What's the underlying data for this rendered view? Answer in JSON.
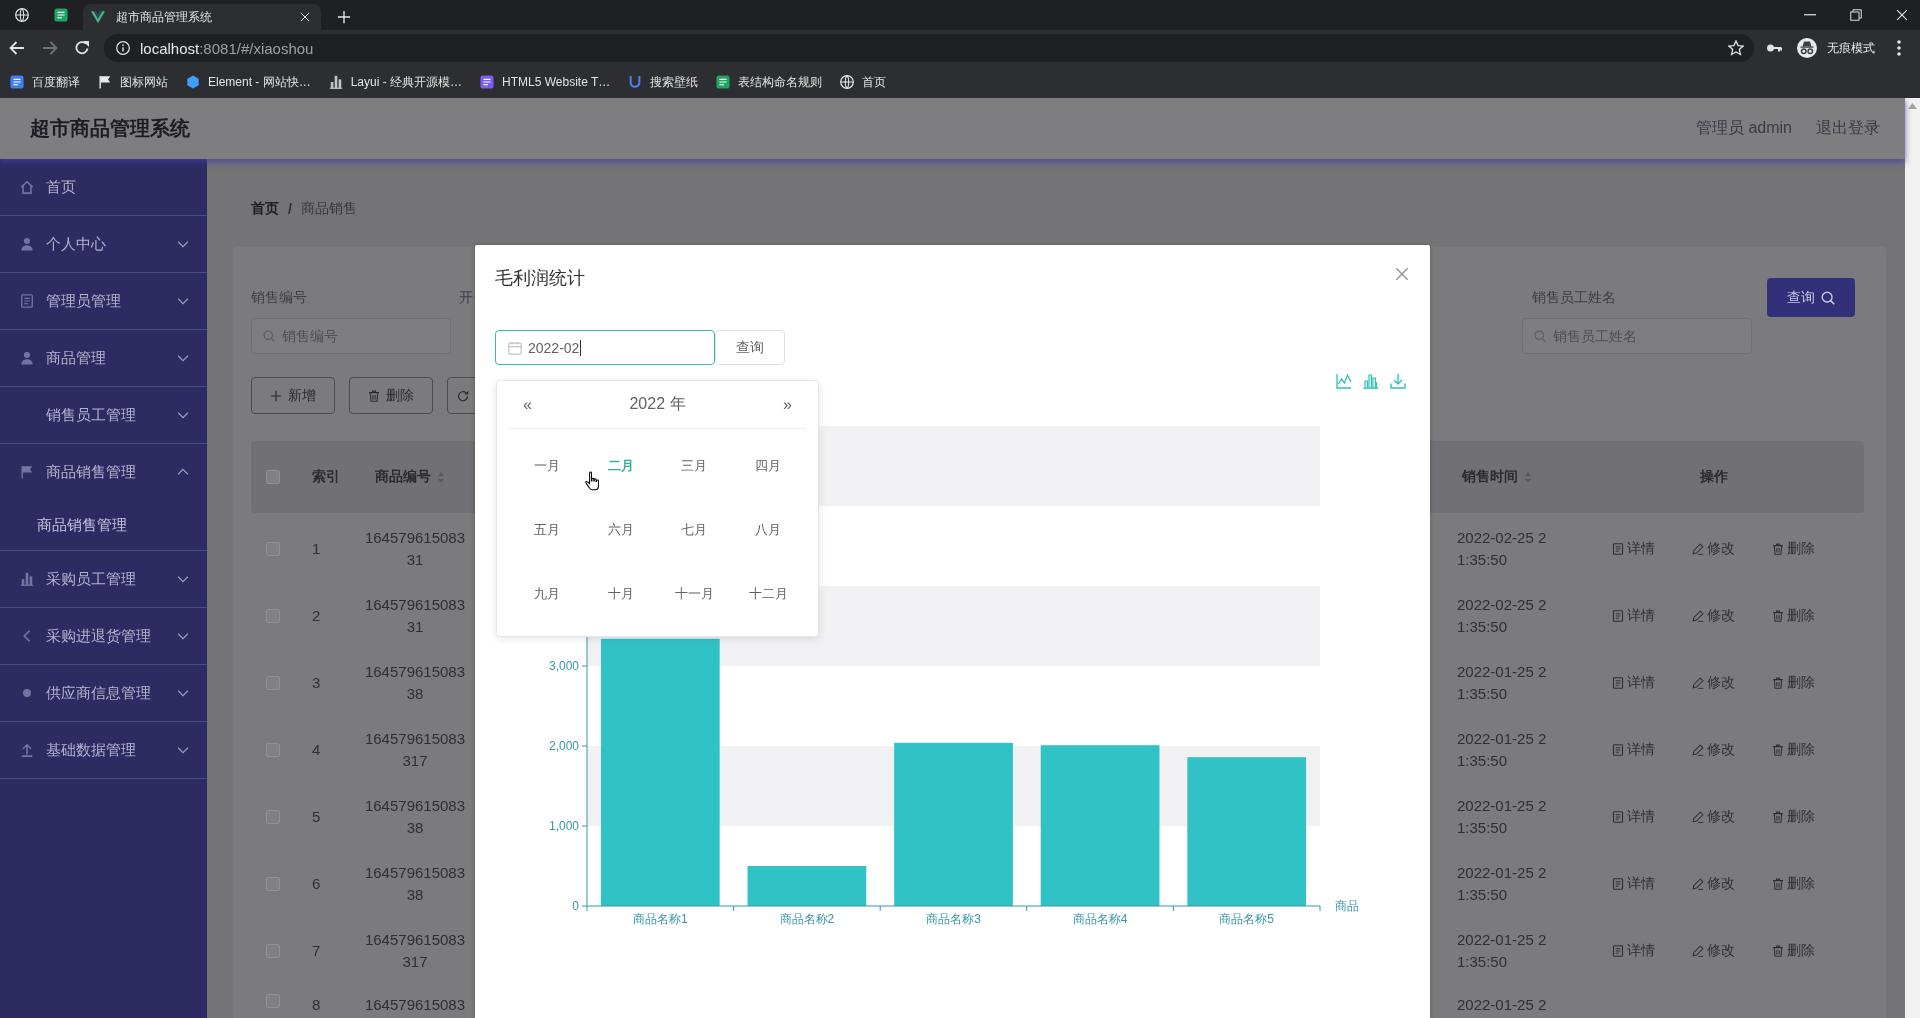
{
  "browser": {
    "tabs": [
      {
        "title": "超市商品管理系统",
        "selected": true
      }
    ],
    "url": {
      "host": "localhost",
      "path": ":8081/#/xiaoshou"
    },
    "profile_label": "无痕模式",
    "bookmarks": [
      "百度翻译",
      "图标网站",
      "Element - 网站快…",
      "Layui - 经典开源模…",
      "HTML5 Website T…",
      "搜索壁纸",
      "表结构命名规则",
      "首页"
    ]
  },
  "header": {
    "title": "超市商品管理系统",
    "user": "管理员 admin",
    "logout": "退出登录"
  },
  "sidebar": {
    "items": [
      {
        "label": "首页",
        "kind": "link"
      },
      {
        "label": "个人中心",
        "kind": "menu",
        "expanded": false
      },
      {
        "label": "管理员管理",
        "kind": "menu",
        "expanded": false
      },
      {
        "label": "商品管理",
        "kind": "menu",
        "expanded": false
      },
      {
        "label": "销售员工管理",
        "kind": "menu",
        "expanded": false
      },
      {
        "label": "商品销售管理",
        "kind": "menu",
        "expanded": true,
        "children": [
          {
            "label": "商品销售管理"
          }
        ]
      },
      {
        "label": "采购员工管理",
        "kind": "menu",
        "expanded": false
      },
      {
        "label": "采购进退货管理",
        "kind": "menu",
        "expanded": false
      },
      {
        "label": "供应商信息管理",
        "kind": "menu",
        "expanded": false
      },
      {
        "label": "基础数据管理",
        "kind": "menu",
        "expanded": false
      }
    ]
  },
  "main": {
    "breadcrumb": {
      "items": [
        "首页",
        "商品销售"
      ],
      "separator": "/"
    },
    "search_form": {
      "left_fields": [
        {
          "label": "销售编号",
          "placeholder": "销售编号"
        },
        {
          "label": "开"
        }
      ],
      "right_fields": [
        {
          "label": "销售员工姓名",
          "placeholder": "销售员工姓名"
        }
      ],
      "button": "查询"
    },
    "buttons": [
      {
        "kind": "add",
        "label": "新增"
      },
      {
        "kind": "delete",
        "label": "删除"
      },
      {
        "kind": "refresh"
      }
    ],
    "table": {
      "header_checkbox": {
        "checked": false
      },
      "columns": [
        {
          "label": "索引",
          "sortable": false
        },
        {
          "label": "商品编号",
          "sortable": true
        },
        {
          "label": "销售时间",
          "sortable": true
        },
        {
          "label": "操作",
          "sortable": false
        }
      ],
      "rows": [
        {
          "checked": false,
          "index": "1",
          "code": "16457961508331",
          "time": "2022-02-25 21:35:50",
          "actions": [
            {
              "kind": "detail",
              "label": "详情"
            },
            {
              "kind": "edit",
              "label": "修改"
            },
            {
              "kind": "delete",
              "label": "删除"
            }
          ]
        },
        {
          "checked": false,
          "index": "2",
          "code": "16457961508331",
          "time": "2022-02-25 21:35:50",
          "actions": [
            {
              "kind": "detail",
              "label": "详情"
            },
            {
              "kind": "edit",
              "label": "修改"
            },
            {
              "kind": "delete",
              "label": "删除"
            }
          ]
        },
        {
          "checked": false,
          "index": "3",
          "code": "16457961508338",
          "time": "2022-01-25 21:35:50",
          "actions": [
            {
              "kind": "detail",
              "label": "详情"
            },
            {
              "kind": "edit",
              "label": "修改"
            },
            {
              "kind": "delete",
              "label": "删除"
            }
          ]
        },
        {
          "checked": false,
          "index": "4",
          "code": "164579615083317",
          "time": "2022-01-25 21:35:50",
          "actions": [
            {
              "kind": "detail",
              "label": "详情"
            },
            {
              "kind": "edit",
              "label": "修改"
            },
            {
              "kind": "delete",
              "label": "删除"
            }
          ]
        },
        {
          "checked": false,
          "index": "5",
          "code": "16457961508338",
          "time": "2022-01-25 21:35:50",
          "actions": [
            {
              "kind": "detail",
              "label": "详情"
            },
            {
              "kind": "edit",
              "label": "修改"
            },
            {
              "kind": "delete",
              "label": "删除"
            }
          ]
        },
        {
          "checked": false,
          "index": "6",
          "code": "16457961508338",
          "time": "2022-01-25 21:35:50",
          "actions": [
            {
              "kind": "detail",
              "label": "详情"
            },
            {
              "kind": "edit",
              "label": "修改"
            },
            {
              "kind": "delete",
              "label": "删除"
            }
          ]
        },
        {
          "checked": false,
          "index": "7",
          "code": "164579615083317",
          "time": "2022-01-25 21:35:50",
          "actions": [
            {
              "kind": "detail",
              "label": "详情"
            },
            {
              "kind": "edit",
              "label": "修改"
            },
            {
              "kind": "delete",
              "label": "删除"
            }
          ]
        },
        {
          "checked": false,
          "index": "8",
          "code": "164579615083",
          "time": "2022-01-25 2"
        }
      ]
    }
  },
  "dialog": {
    "title": "毛利润统计",
    "date_input": {
      "value": "2022-02",
      "focused": true,
      "expanded": true
    },
    "query_button": "查询",
    "date_picker": {
      "prev": "«",
      "year_label": "2022 年",
      "next": "»",
      "months": [
        {
          "label": "一月",
          "selected": false
        },
        {
          "label": "二月",
          "selected": true
        },
        {
          "label": "三月",
          "selected": false
        },
        {
          "label": "四月",
          "selected": false
        },
        {
          "label": "五月",
          "selected": false
        },
        {
          "label": "六月",
          "selected": false
        },
        {
          "label": "七月",
          "selected": false
        },
        {
          "label": "八月",
          "selected": false
        },
        {
          "label": "九月",
          "selected": false
        },
        {
          "label": "十月",
          "selected": false
        },
        {
          "label": "十一月",
          "selected": false
        },
        {
          "label": "十二月",
          "selected": false
        }
      ]
    },
    "chart_data": {
      "type": "bar",
      "xlabel": "商品",
      "categories": [
        "商品名称1",
        "商品名称2",
        "商品名称3",
        "商品名称4",
        "商品名称5"
      ],
      "values": [
        3340,
        500,
        2040,
        2010,
        1860
      ],
      "ylim": [
        0,
        6000
      ],
      "yticks": [
        {
          "value": 0,
          "label": "0"
        },
        {
          "value": 1000,
          "label": "1,000"
        },
        {
          "value": 2000,
          "label": "2,000"
        },
        {
          "value": 3000,
          "label": "3,000"
        }
      ],
      "bands": [
        {
          "axis": "y",
          "from": 1000,
          "to": 2000
        },
        {
          "axis": "y",
          "from": 3000,
          "to": 4000
        },
        {
          "axis": "y",
          "from": 5000,
          "to": 6000
        }
      ]
    }
  }
}
